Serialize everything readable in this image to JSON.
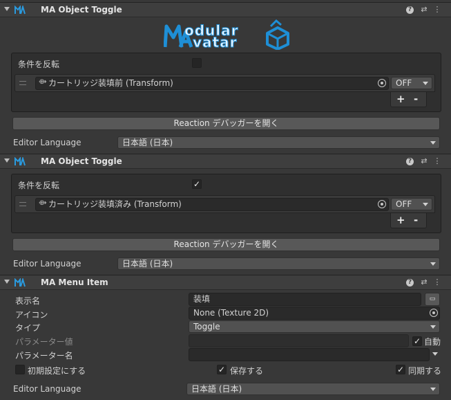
{
  "logo": {
    "line1": "odular",
    "line2": "vatar",
    "brand_color": "#1e8fd6"
  },
  "toggle1": {
    "title": "MA Object Toggle",
    "invert_label": "条件を反転",
    "invert_checked": false,
    "object_name": "カートリッジ装填前 (Transform)",
    "state": "OFF",
    "plus": "+",
    "minus": "-",
    "debugger_button": "Reaction デバッガーを開く",
    "language_label": "Editor Language",
    "language_value": "日本語 (日本)"
  },
  "toggle2": {
    "title": "MA Object Toggle",
    "invert_label": "条件を反転",
    "invert_checked": true,
    "check_mark": "✓",
    "object_name": "カートリッジ装填済み (Transform)",
    "state": "OFF",
    "plus": "+",
    "minus": "-",
    "debugger_button": "Reaction デバッガーを開く",
    "language_label": "Editor Language",
    "language_value": "日本語 (日本)"
  },
  "menu_item": {
    "title": "MA Menu Item",
    "display_name_label": "表示名",
    "display_name_value": "装填",
    "icon_label": "アイコン",
    "icon_value": "None (Texture 2D)",
    "type_label": "タイプ",
    "type_value": "Toggle",
    "param_value_label": "パラメーター値",
    "auto_label": "自動",
    "param_name_label": "パラメーター名",
    "default_label": "初期設定にする",
    "saved_label": "保存する",
    "synced_label": "同期する",
    "check_mark": "✓",
    "language_label": "Editor Language",
    "language_value": "日本語 (日本)"
  },
  "header_icons": {
    "help": "?",
    "settings": "⇄",
    "more": "⋮"
  }
}
